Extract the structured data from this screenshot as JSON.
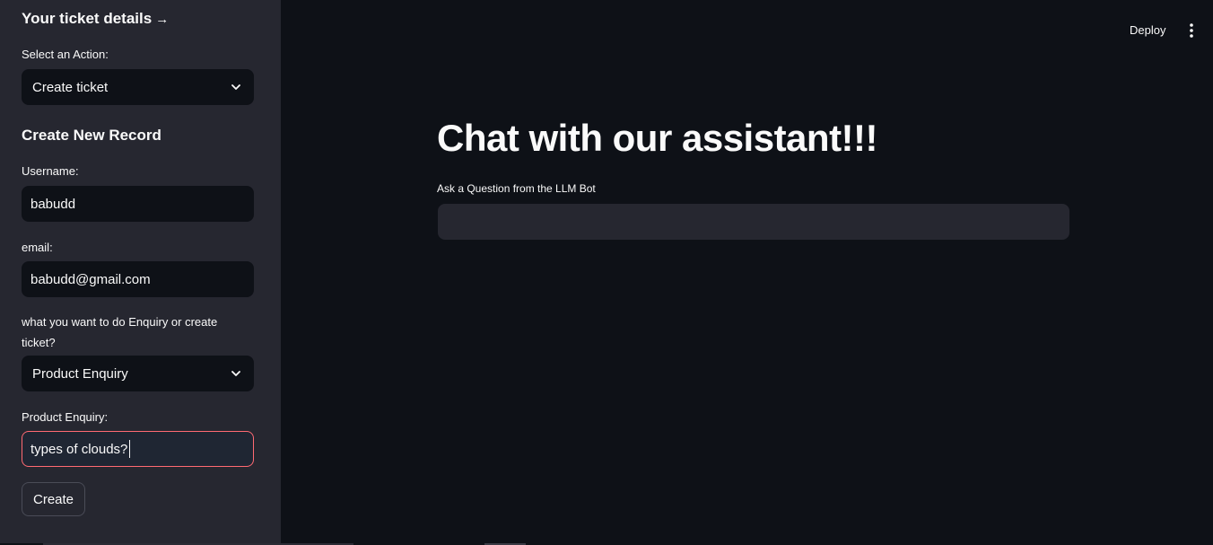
{
  "sidebar": {
    "title": "Your ticket details",
    "title_arrow": "→",
    "action_label": "Select an Action:",
    "action_value": "Create ticket",
    "section_title": "Create New Record",
    "username_label": "Username:",
    "username_value": "babudd",
    "email_label": "email:",
    "email_value": "babudd@gmail.com",
    "intent_label": "what you want to do Enquiry or create ticket?",
    "intent_value": "Product Enquiry",
    "enquiry_label": "Product Enquiry:",
    "enquiry_value": "types of clouds?",
    "create_button": "Create"
  },
  "header": {
    "deploy_label": "Deploy",
    "menu_icon": "kebab-menu-icon"
  },
  "main": {
    "title": "Chat with our assistant!!!",
    "question_label": "Ask a Question from the LLM Bot",
    "question_value": ""
  },
  "colors": {
    "background": "#0e1117",
    "sidebar": "#262730",
    "input_bg": "#262730",
    "focus_border": "#ff6a72",
    "text": "#fafafa"
  }
}
